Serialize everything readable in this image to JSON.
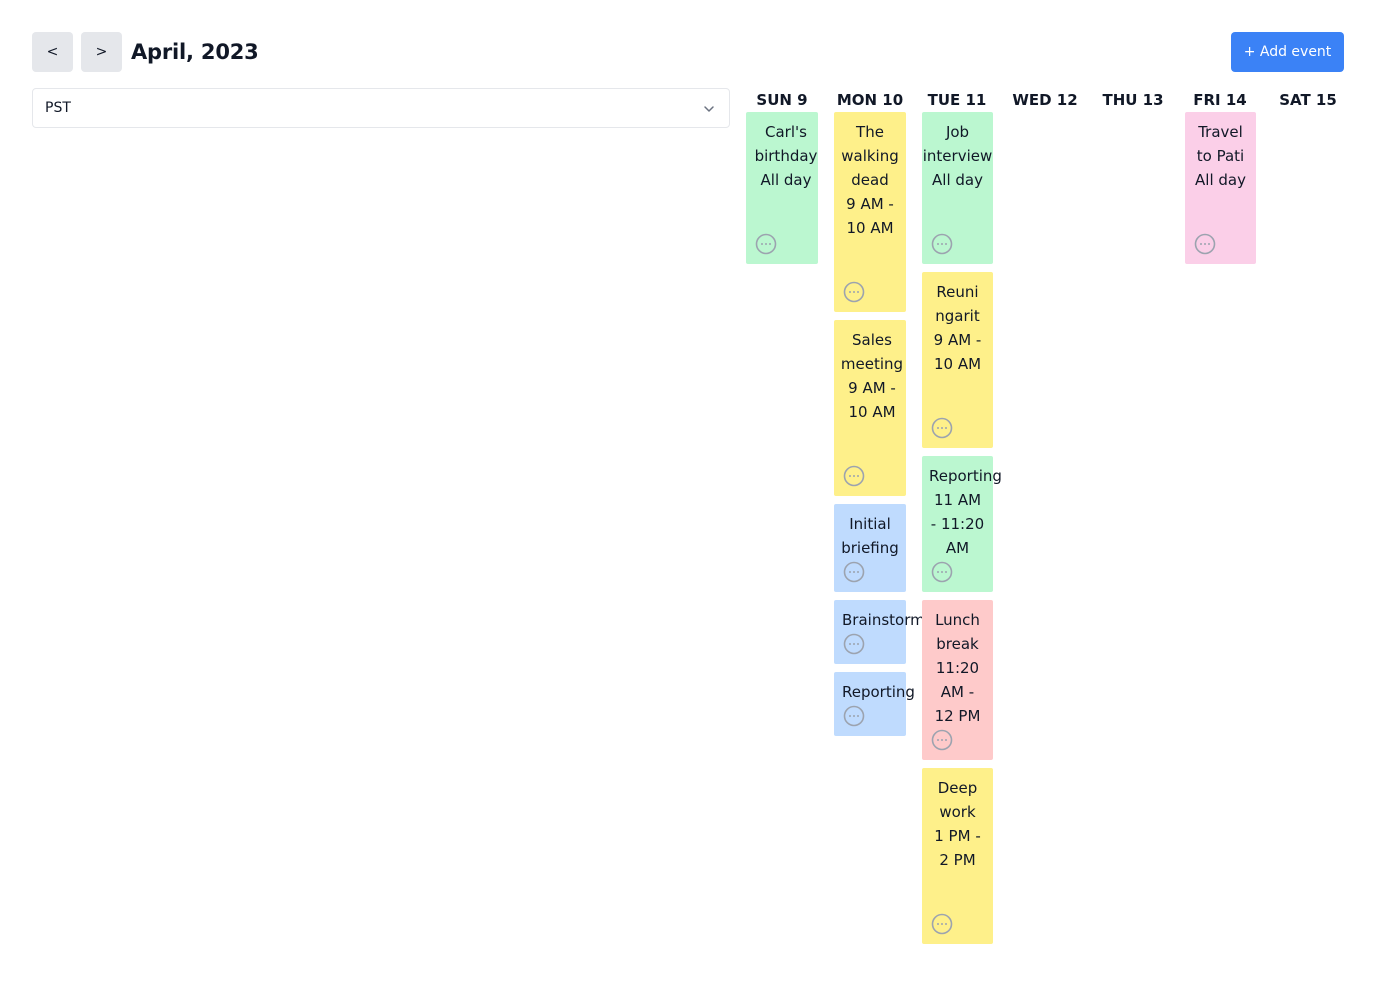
{
  "header": {
    "prev_label": "<",
    "next_label": ">",
    "month_title": "April, 2023",
    "add_event_label": "+ Add event"
  },
  "timezone": {
    "selected": "PST"
  },
  "days": [
    {
      "label": "SUN 9"
    },
    {
      "label": "MON 10"
    },
    {
      "label": "TUE 11"
    },
    {
      "label": "WED 12"
    },
    {
      "label": "THU 13"
    },
    {
      "label": "FRI 14"
    },
    {
      "label": "SAT 15"
    }
  ],
  "events": [
    {
      "day": "SUN 9",
      "lines": [
        "Carl's",
        "birthday",
        "All day"
      ],
      "color": "#bbf7d0"
    },
    {
      "day": "MON 10",
      "lines": [
        "The",
        "walking",
        "dead",
        "9 AM -",
        "10 AM"
      ],
      "color": "#fef08a"
    },
    {
      "day": "MON 10",
      "lines": [
        "Sales",
        "meeting",
        "9 AM -",
        "10 AM"
      ],
      "color": "#fef08a"
    },
    {
      "day": "MON 10",
      "lines": [
        "Initial",
        "briefing"
      ],
      "color": "#bfdbfe"
    },
    {
      "day": "MON 10",
      "lines": [
        "Brainstorm"
      ],
      "color": "#bfdbfe"
    },
    {
      "day": "MON 10",
      "lines": [
        "Reporting"
      ],
      "color": "#bfdbfe"
    },
    {
      "day": "TUE 11",
      "lines": [
        "Job",
        "interview",
        "All day"
      ],
      "color": "#bbf7d0"
    },
    {
      "day": "TUE 11",
      "lines": [
        "Reuni",
        "ngarit",
        "9 AM -",
        "10 AM"
      ],
      "color": "#fef08a"
    },
    {
      "day": "TUE 11",
      "lines": [
        "Reporting",
        "11 AM",
        "- 11:20",
        "AM"
      ],
      "color": "#bbf7d0"
    },
    {
      "day": "TUE 11",
      "lines": [
        "Lunch",
        "break",
        "11:20",
        "AM -",
        "12 PM"
      ],
      "color": "#fecaca"
    },
    {
      "day": "TUE 11",
      "lines": [
        "Deep",
        "work",
        "1 PM -",
        "2 PM"
      ],
      "color": "#fef08a"
    },
    {
      "day": "FRI 14",
      "lines": [
        "Travel",
        "to Pati",
        "All day"
      ],
      "color": "#fbcfe8"
    }
  ],
  "icons": {
    "more": "ellipsis-circle-icon",
    "chevron": "chevron-down-icon"
  }
}
